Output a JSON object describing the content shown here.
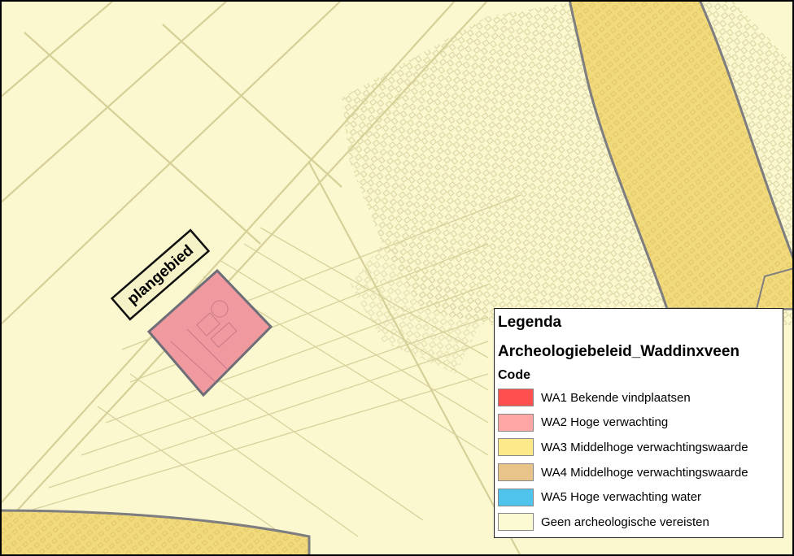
{
  "map": {
    "plan_label": "plangebied",
    "colors": {
      "background": "#FBF8D0",
      "urban_pattern": "#E3DCAB",
      "wa3_fill": "#F3DE82",
      "wa3_border": "#8A8A86",
      "plan_fill": "#F09AA0",
      "plan_border": "#6E6E78",
      "label_bg": "#F6F2C8"
    }
  },
  "legend": {
    "title": "Legenda",
    "layer": "Archeologiebeleid_Waddinxveen",
    "field": "Code",
    "items": [
      {
        "label": "WA1 Bekende vindplaatsen",
        "color": "#FF5050"
      },
      {
        "label": "WA2 Hoge verwachting",
        "color": "#FFA6A6"
      },
      {
        "label": "WA3 Middelhoge verwachtingswaarde",
        "color": "#FCE98A"
      },
      {
        "label": "WA4 Middelhoge verwachtingswaarde",
        "color": "#E9C48A"
      },
      {
        "label": "WA5 Hoge verwachting water",
        "color": "#4FC3EC"
      },
      {
        "label": "Geen archeologische vereisten",
        "color": "#FBFAD2"
      }
    ]
  }
}
